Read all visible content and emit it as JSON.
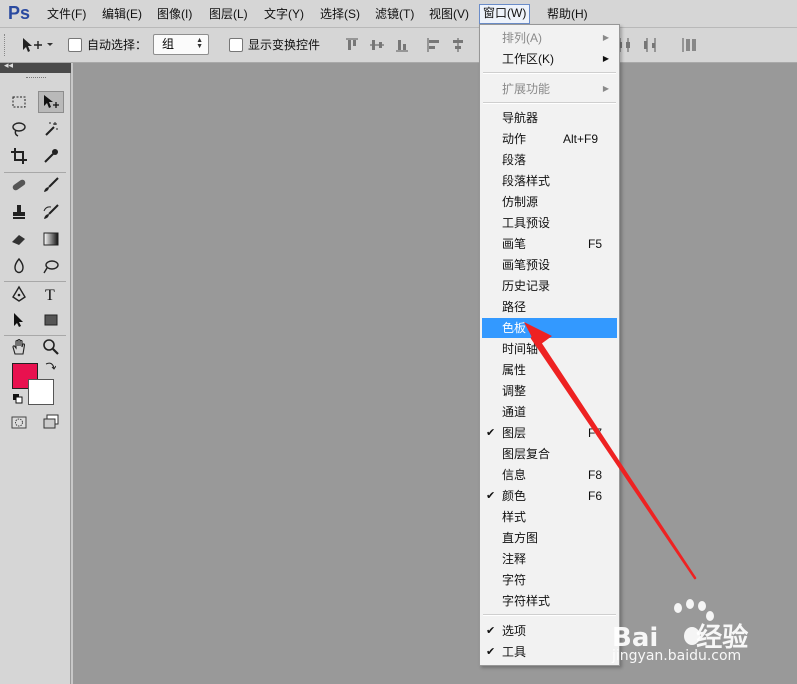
{
  "app": {
    "logo": "Ps"
  },
  "menubar": {
    "items": [
      {
        "label": "文件(F)"
      },
      {
        "label": "编辑(E)"
      },
      {
        "label": "图像(I)"
      },
      {
        "label": "图层(L)"
      },
      {
        "label": "文字(Y)"
      },
      {
        "label": "选择(S)"
      },
      {
        "label": "滤镜(T)"
      },
      {
        "label": "视图(V)"
      },
      {
        "label": "窗口(W)"
      },
      {
        "label": "帮助(H)"
      }
    ],
    "active": "窗口(W)"
  },
  "options": {
    "auto_select_label": "自动选择：",
    "auto_select_value": "组",
    "show_transform_label": "显示变换控件"
  },
  "colors": {
    "foreground": "#e8114f",
    "background": "#ffffff",
    "highlight": "#3399ff",
    "annotation": "#ee2222"
  },
  "window_menu": {
    "items": [
      {
        "label": "排列(A)",
        "submenu": true,
        "disabled": true
      },
      {
        "label": "工作区(K)",
        "submenu": true
      },
      {
        "label": "扩展功能",
        "submenu": true,
        "disabled": true
      },
      {
        "label": "导航器"
      },
      {
        "label": "动作",
        "shortcut": "Alt+F9"
      },
      {
        "label": "段落"
      },
      {
        "label": "段落样式"
      },
      {
        "label": "仿制源"
      },
      {
        "label": "工具预设"
      },
      {
        "label": "画笔",
        "shortcut": "F5"
      },
      {
        "label": "画笔预设"
      },
      {
        "label": "历史记录"
      },
      {
        "label": "路径"
      },
      {
        "label": "色板",
        "highlighted": true
      },
      {
        "label": "时间轴"
      },
      {
        "label": "属性"
      },
      {
        "label": "调整"
      },
      {
        "label": "通道"
      },
      {
        "label": "图层",
        "shortcut": "F7",
        "checked": true
      },
      {
        "label": "图层复合"
      },
      {
        "label": "信息",
        "shortcut": "F8"
      },
      {
        "label": "颜色",
        "shortcut": "F6",
        "checked": true
      },
      {
        "label": "样式"
      },
      {
        "label": "直方图"
      },
      {
        "label": "注释"
      },
      {
        "label": "字符"
      },
      {
        "label": "字符样式"
      },
      {
        "label": "选项",
        "checked": true
      },
      {
        "label": "工具",
        "checked": true
      }
    ]
  },
  "watermark": {
    "brand": "Bai",
    "brand2": "经验",
    "url": "jingyan.baidu.com"
  },
  "toolbox": {
    "icons": [
      "marquee-icon",
      "move-icon",
      "lasso-icon",
      "magic-wand-icon",
      "crop-icon",
      "eyedropper-icon",
      "healing-brush-icon",
      "brush-icon",
      "clone-stamp-icon",
      "history-brush-icon",
      "eraser-icon",
      "gradient-icon",
      "blur-icon",
      "dodge-icon",
      "pen-icon",
      "type-icon",
      "path-select-icon",
      "rectangle-icon",
      "hand-icon",
      "zoom-icon"
    ]
  }
}
